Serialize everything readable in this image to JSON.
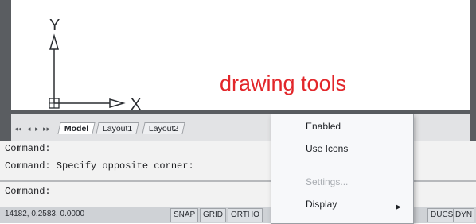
{
  "drawing": {
    "y_axis_label": "Y",
    "x_axis_label": "X",
    "annotation": "drawing tools"
  },
  "layout_tabs": {
    "nav": [
      "◂◂",
      "◂",
      "▸",
      "▸▸"
    ],
    "tabs": [
      "Model",
      "Layout1",
      "Layout2"
    ],
    "active": "Model"
  },
  "command_window": {
    "lines": [
      "Command:",
      "Command: Specify opposite corner:",
      "Command:"
    ]
  },
  "context_menu": {
    "items": [
      "Enabled",
      "Use Icons",
      "Settings...",
      "Display"
    ],
    "disabled": [
      "Settings..."
    ]
  },
  "status_bar": {
    "coordinates": "14182, 0.2583, 0.0000",
    "buttons": [
      "SNAP",
      "GRID",
      "ORTHO",
      "DUCS",
      "DYN"
    ]
  },
  "colors": {
    "annotation": "#e2262a",
    "frame": "#5a5d61"
  }
}
